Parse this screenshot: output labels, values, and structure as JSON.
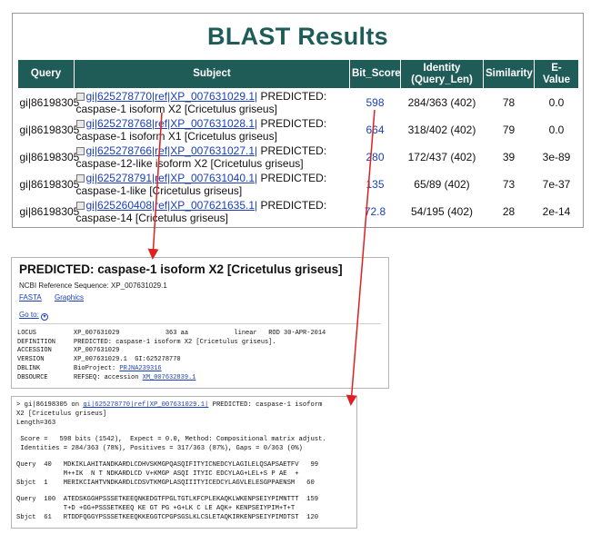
{
  "blast": {
    "title": "BLAST Results",
    "headers": {
      "query": "Query",
      "subject": "Subject",
      "bit_score": "Bit_Score",
      "identity": "Identity (Query_Len)",
      "similarity": "Similarity",
      "evalue": "E-Value"
    },
    "rows": [
      {
        "query": "gi|86198305",
        "gi_link": "gi|625278770|",
        "ref_link": "ref|XP_007631029.1|",
        "desc": "PREDICTED: caspase-1 isoform X2 [Cricetulus griseus]",
        "bit_score": "598",
        "identity": "284/363 (402)",
        "similarity": "78",
        "evalue": "0.0"
      },
      {
        "query": "gi|86198305",
        "gi_link": "gi|625278768|",
        "ref_link": "ref|XP_007631028.1|",
        "desc": "PREDICTED: caspase-1 isoform X1 [Cricetulus griseus]",
        "bit_score": "664",
        "identity": "318/402 (402)",
        "similarity": "79",
        "evalue": "0.0"
      },
      {
        "query": "gi|86198305",
        "gi_link": "gi|625278766|",
        "ref_link": "ref|XP_007631027.1|",
        "desc": "PREDICTED: caspase-12-like isoform X2 [Cricetulus griseus]",
        "bit_score": "280",
        "identity": "172/437 (402)",
        "similarity": "39",
        "evalue": "3e-89"
      },
      {
        "query": "gi|86198305",
        "gi_link": "gi|625278791|",
        "ref_link": "ref|XP_007631040.1|",
        "desc": "PREDICTED: caspase-1-like [Cricetulus griseus]",
        "bit_score": "135",
        "identity": "65/89 (402)",
        "similarity": "73",
        "evalue": "7e-37"
      },
      {
        "query": "gi|86198305",
        "gi_link": "gi|625260408|",
        "ref_link": "ref|XP_007621635.1|",
        "desc": "PREDICTED: caspase-14 [Cricetulus griseus]",
        "bit_score": "72.8",
        "identity": "54/195 (402)",
        "similarity": "28",
        "evalue": "2e-14"
      }
    ]
  },
  "ncbi": {
    "title": "PREDICTED: caspase-1 isoform X2 [Cricetulus griseus]",
    "reference": "NCBI Reference Sequence: XP_007631029.1",
    "format_fasta": "FASTA",
    "format_graphics": "Graphics",
    "goto": "Go to:",
    "goto_icon": "chevron-down-circle-icon",
    "record": {
      "locus_key": "LOCUS",
      "locus_val": "XP_007631029            363 aa            linear   ROD 30-APR-2014",
      "definition_key": "DEFINITION",
      "definition_val": "PREDICTED: caspase-1 isoform X2 [Cricetulus griseus].",
      "accession_key": "ACCESSION",
      "accession_val": "XP_007631029",
      "version_key": "VERSION",
      "version_val": "XP_007631029.1  GI:625278770",
      "dblink_key": "DBLINK",
      "dblink_prefix": "BioProject: ",
      "dblink_link": "PRJNA239316",
      "dbsource_key": "DBSOURCE",
      "dbsource_prefix": "REFSEQ: accession ",
      "dbsource_link": "XM_007632839.1"
    }
  },
  "alignment": {
    "header_prefix": "> gi|86198305 on ",
    "header_link": "gi|625278770|ref|XP_007631029.1|",
    "header_suffix": " PREDICTED: caspase-1 isoform",
    "header_line2": "X2 [Cricetulus griseus]",
    "length": "Length=363",
    "score_line": " Score =   598 bits (1542),  Expect = 0.0, Method: Compositional matrix adjust.",
    "identities_line": " Identities = 284/363 (78%), Positives = 317/363 (87%), Gaps = 0/363 (0%)",
    "block1_query": "Query  40   MDKIKLAHITANDKARDLCDHVSKMGPQASQIFITYICNEDCYLAGILELQSAPSAETFV   99",
    "block1_mid": "            M++IK  N T NDKARDLCD V+KMGP ASQI ITYIC EDCYLAG+LEL+S P AE  +",
    "block1_sbjct": "Sbjct  1    MERIKCIAHTVNDKARDLCDSVTKMGPLASQIIITYICEDCYLAGVLELESGPPAENSM   60",
    "block2_query": "Query  100  ATEDSKGGHPSSSETKEEQNKEDGTFPGLTGTLKFCPLEKAQKLWKENPSEIYPIMNTTT  159",
    "block2_mid": "            T+D +GG+PSSSETKEEQ KE GT PG +G+LK C LE AQK+ KENPSEIYPIM+T+T",
    "block2_sbjct": "Sbjct  61   RTDDFQGGYPSSSETKEEQKKEGGTCPGPSGSLKLCSLETAQKIRKENPSEIYPIMDTST  120"
  },
  "colors": {
    "header_bg": "#1f5c58",
    "title_color": "#1d5c58",
    "link": "#1a3fb8",
    "arrow": "#e02020"
  }
}
